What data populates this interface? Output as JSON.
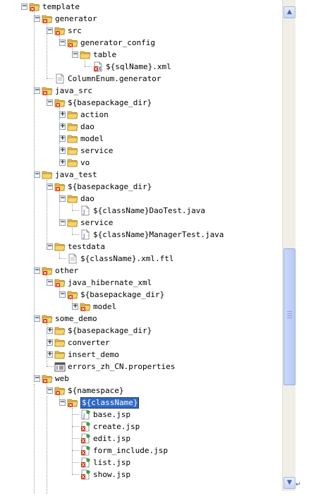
{
  "nodes": [
    {
      "label": "template",
      "depth": 0,
      "icon": "package-folder-icon",
      "state": "open"
    },
    {
      "label": "generator",
      "depth": 1,
      "icon": "package-folder-icon",
      "state": "open"
    },
    {
      "label": "src",
      "depth": 2,
      "icon": "package-folder-icon",
      "state": "open"
    },
    {
      "label": "generator_config",
      "depth": 3,
      "icon": "package-folder-icon",
      "state": "open"
    },
    {
      "label": "table",
      "depth": 4,
      "icon": "folder-icon",
      "state": "open"
    },
    {
      "label": "${sqlName}.xml",
      "depth": 5,
      "icon": "xml-file-icon",
      "state": "leaf"
    },
    {
      "label": "ColumnEnum.generator",
      "depth": 2,
      "icon": "text-file-icon",
      "state": "leaf"
    },
    {
      "label": "java_src",
      "depth": 1,
      "icon": "package-folder-icon",
      "state": "open"
    },
    {
      "label": "${basepackage_dir}",
      "depth": 2,
      "icon": "package-folder-icon",
      "state": "open"
    },
    {
      "label": "action",
      "depth": 3,
      "icon": "folder-icon",
      "state": "closed"
    },
    {
      "label": "dao",
      "depth": 3,
      "icon": "folder-icon",
      "state": "closed"
    },
    {
      "label": "model",
      "depth": 3,
      "icon": "folder-icon",
      "state": "closed"
    },
    {
      "label": "service",
      "depth": 3,
      "icon": "folder-icon",
      "state": "closed"
    },
    {
      "label": "vo",
      "depth": 3,
      "icon": "folder-icon",
      "state": "closed"
    },
    {
      "label": "java_test",
      "depth": 1,
      "icon": "folder-icon",
      "state": "open"
    },
    {
      "label": "${basepackage_dir}",
      "depth": 2,
      "icon": "package-folder-icon",
      "state": "open"
    },
    {
      "label": "dao",
      "depth": 3,
      "icon": "folder-icon",
      "state": "open"
    },
    {
      "label": "${className}DaoTest.java",
      "depth": 4,
      "icon": "java-file-icon",
      "state": "leaf"
    },
    {
      "label": "service",
      "depth": 3,
      "icon": "folder-icon",
      "state": "open"
    },
    {
      "label": "${className}ManagerTest.java",
      "depth": 4,
      "icon": "java-file-icon",
      "state": "leaf"
    },
    {
      "label": "testdata",
      "depth": 2,
      "icon": "folder-icon",
      "state": "open"
    },
    {
      "label": "${className}.xml.ftl",
      "depth": 3,
      "icon": "text-file-icon",
      "state": "leaf"
    },
    {
      "label": "other",
      "depth": 1,
      "icon": "package-folder-icon",
      "state": "open"
    },
    {
      "label": "java_hibernate_xml",
      "depth": 2,
      "icon": "package-folder-icon",
      "state": "open"
    },
    {
      "label": "${basepackage_dir}",
      "depth": 3,
      "icon": "package-folder-icon",
      "state": "open"
    },
    {
      "label": "model",
      "depth": 4,
      "icon": "package-folder-icon",
      "state": "closed"
    },
    {
      "label": "some_demo",
      "depth": 1,
      "icon": "package-folder-icon",
      "state": "open"
    },
    {
      "label": "${basepackage_dir}",
      "depth": 2,
      "icon": "folder-icon",
      "state": "closed"
    },
    {
      "label": "converter",
      "depth": 2,
      "icon": "folder-icon",
      "state": "closed"
    },
    {
      "label": "insert_demo",
      "depth": 2,
      "icon": "folder-icon",
      "state": "closed"
    },
    {
      "label": "errors_zh_CN.properties",
      "depth": 2,
      "icon": "properties-file-icon",
      "state": "leaf"
    },
    {
      "label": "web",
      "depth": 1,
      "icon": "package-folder-icon",
      "state": "open"
    },
    {
      "label": "${namespace}",
      "depth": 2,
      "icon": "package-folder-icon",
      "state": "open"
    },
    {
      "label": "${className}",
      "depth": 3,
      "icon": "package-folder-icon",
      "state": "open",
      "selected": true
    },
    {
      "label": "base.jsp",
      "depth": 4,
      "icon": "jsp-file-icon",
      "state": "leaf"
    },
    {
      "label": "create.jsp",
      "depth": 4,
      "icon": "jsp-error-file-icon",
      "state": "leaf"
    },
    {
      "label": "edit.jsp",
      "depth": 4,
      "icon": "jsp-error-file-icon",
      "state": "leaf"
    },
    {
      "label": "form_include.jsp",
      "depth": 4,
      "icon": "jsp-error-file-icon",
      "state": "leaf"
    },
    {
      "label": "list.jsp",
      "depth": 4,
      "icon": "jsp-error-file-icon",
      "state": "leaf"
    },
    {
      "label": "show.jsp",
      "depth": 4,
      "icon": "jsp-error-file-icon",
      "state": "leaf"
    }
  ],
  "scrollbar": {
    "position": 0.72,
    "up_icon": "scroll-up-arrow-icon",
    "down_icon": "scroll-down-arrow-icon"
  },
  "end_mark": "↵",
  "colors": {
    "folder": "#f5d46b",
    "package_mark": "#cc2200",
    "selection": "#316ac5",
    "tree_lines": "#9a9a9a"
  }
}
